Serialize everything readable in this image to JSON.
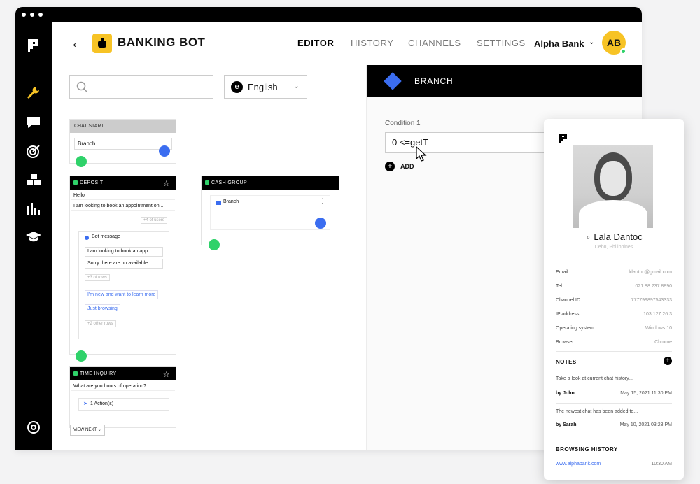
{
  "topbar": {
    "bot_title": "BANKING BOT",
    "nav": [
      "EDITOR",
      "HISTORY",
      "CHANNELS",
      "SETTINGS"
    ],
    "org": "Alpha Bank",
    "avatar": "AB"
  },
  "lang": {
    "badge": "e",
    "label": "English"
  },
  "canvas": {
    "chat_start": "CHAT START",
    "chat_start_item": "Branch",
    "deposit": {
      "title": "DEPOSIT",
      "rows": [
        "Hello",
        "I am looking to book an appointment on..."
      ],
      "more": "+4 of users",
      "bot_message": "Bot message",
      "msgs": [
        "I am looking to book an app...",
        "Sorry there are no available..."
      ],
      "more2": "+3 of rows",
      "links": [
        "I'm new and want to learn more",
        "Just browsing"
      ],
      "more3": "+2 other rows"
    },
    "cash_group": {
      "title": "CASH GROUP",
      "item": "Branch"
    },
    "time_inquiry": {
      "title": "TIME INQUIRY",
      "question": "What are you hours of operation?",
      "actions": "1 Action(s)"
    },
    "view_next": "VIEW NEXT"
  },
  "editor": {
    "title": "BRANCH",
    "condition_label": "Condition 1",
    "condition_value": "0 <=getT",
    "add": "ADD"
  },
  "profile": {
    "name": "Lala Dantoc",
    "location": "Cebu, Philippines",
    "fields": [
      {
        "k": "Email",
        "v": "ldantoc@gmail.com"
      },
      {
        "k": "Tel",
        "v": "021 88 237 8890"
      },
      {
        "k": "Channel ID",
        "v": "777799897543333"
      },
      {
        "k": "IP address",
        "v": "103.127.26.3"
      },
      {
        "k": "Operating system",
        "v": "Windows 10"
      },
      {
        "k": "Browser",
        "v": "Chrome"
      }
    ],
    "notes_title": "NOTES",
    "notes": [
      {
        "text": "Take a look at current chat history...",
        "by": "by John",
        "date": "May 15, 2021 11:30 PM"
      },
      {
        "text": "The newest chat has been added to...",
        "by": "by Sarah",
        "date": "May 10, 2021 03:23 PM"
      }
    ],
    "browsing_title": "BROWSING HISTORY",
    "browsing": [
      {
        "url": "www.alphabank.com",
        "time": "10:30 AM"
      }
    ]
  },
  "colors": {
    "accent": "#f7c325",
    "blue": "#3b6df0",
    "green": "#2fd26a"
  }
}
